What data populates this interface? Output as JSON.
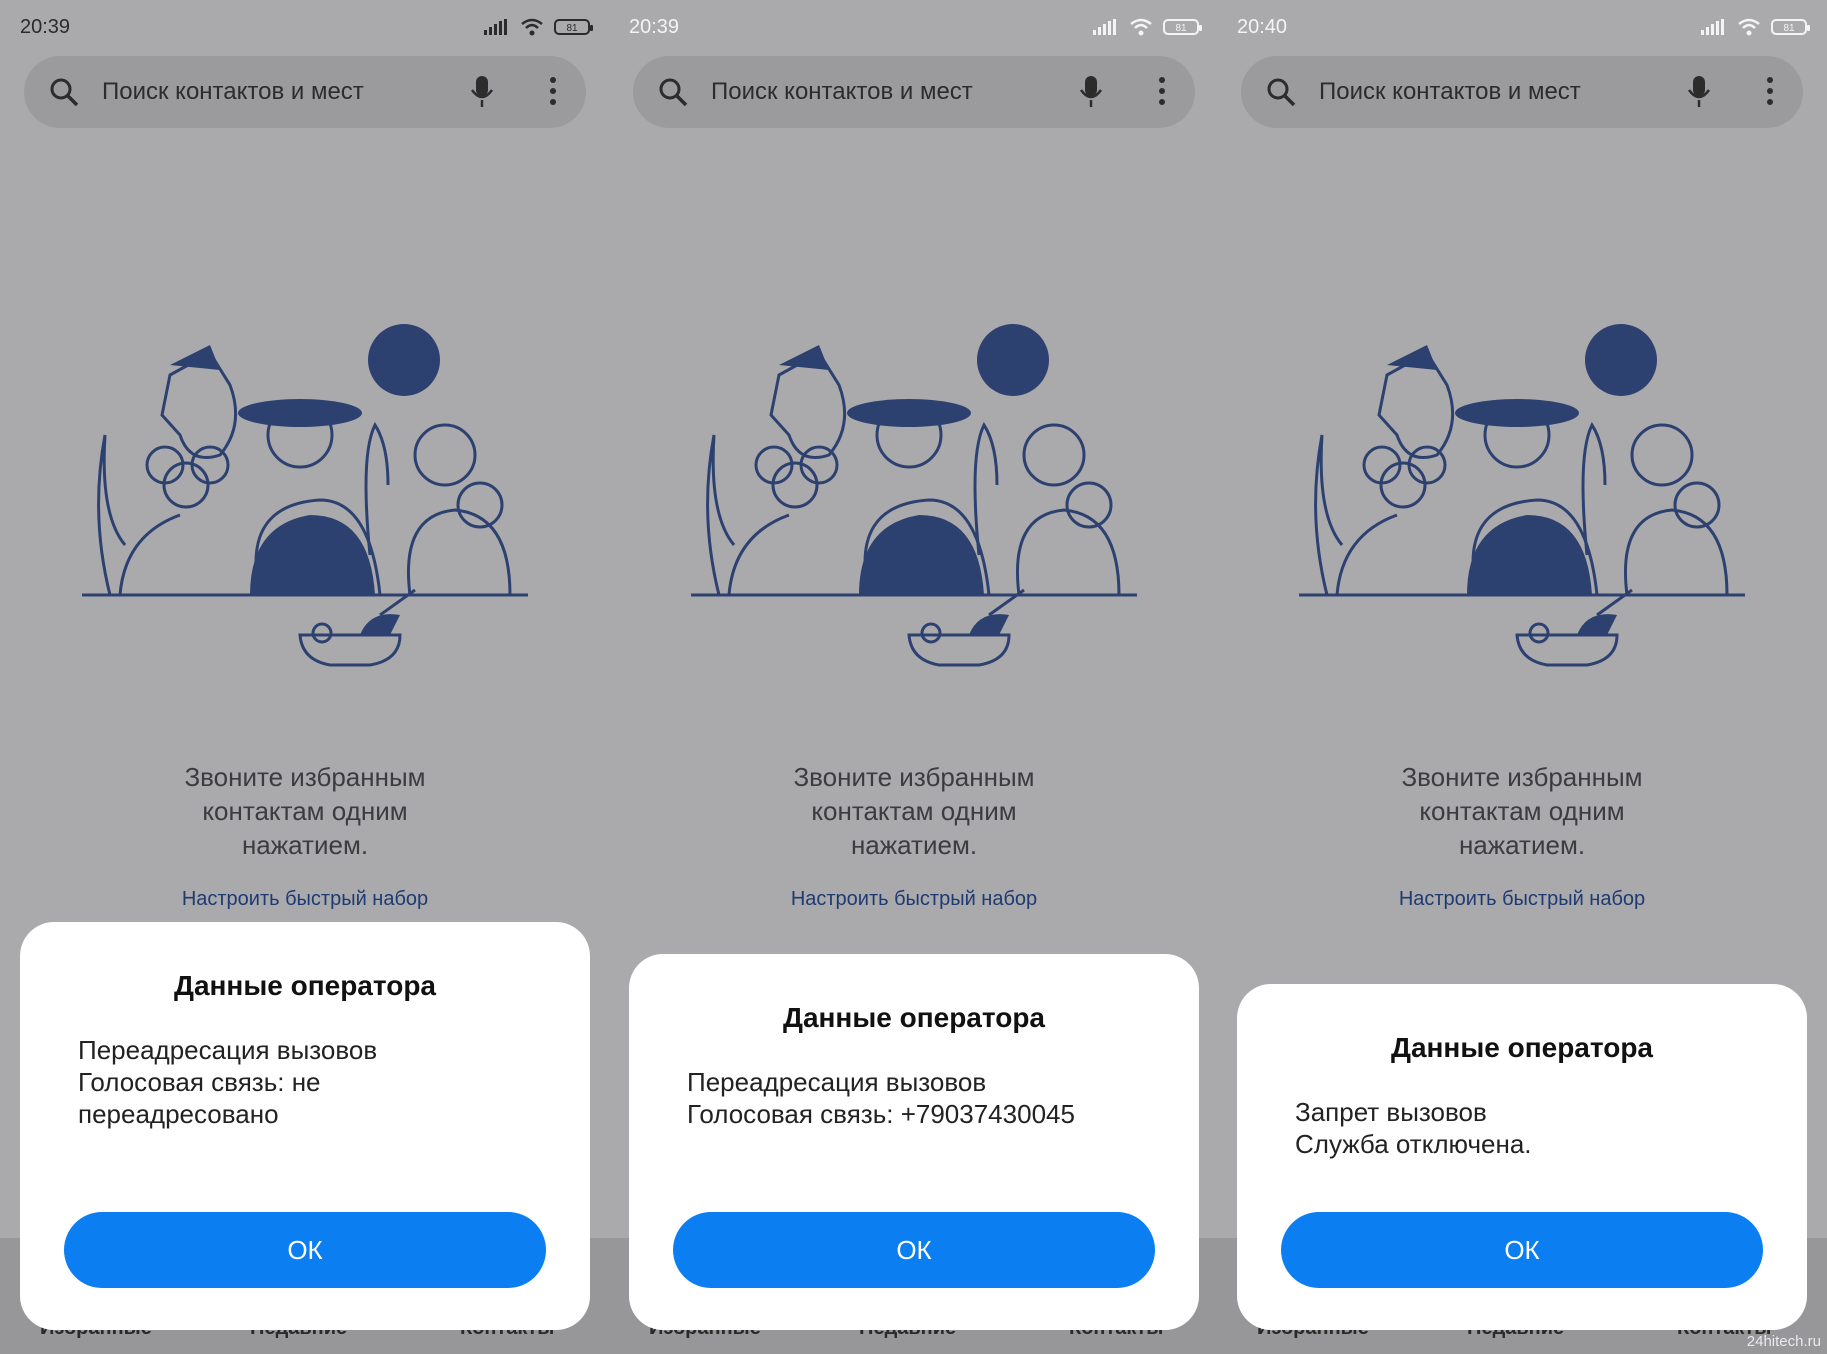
{
  "search": {
    "placeholder": "Поиск контактов и мест"
  },
  "promo": {
    "line1": "Звоните избранным",
    "line2": "контактам одним",
    "line3": "нажатием."
  },
  "setup_link": "Настроить быстрый набор",
  "bottom_tabs": [
    "Избранные",
    "Недавние",
    "Контакты"
  ],
  "dialog_title": "Данные оператора",
  "ok_label": "ОК",
  "watermark": "24hitech.ru",
  "colors": {
    "accent": "#0b7ef2",
    "illustration": "#2d4170",
    "background": "#aaaaad"
  },
  "screens": [
    {
      "time": "20:39",
      "battery": "81",
      "message": [
        "Переадресация вызовов",
        "Голосовая связь: не",
        "переадресовано"
      ]
    },
    {
      "time": "20:39",
      "battery": "81",
      "message": [
        "Переадресация вызовов",
        "Голосовая связь: +79037430045"
      ]
    },
    {
      "time": "20:40",
      "battery": "81",
      "message": [
        "Запрет вызовов",
        "Служба отключена."
      ]
    }
  ]
}
